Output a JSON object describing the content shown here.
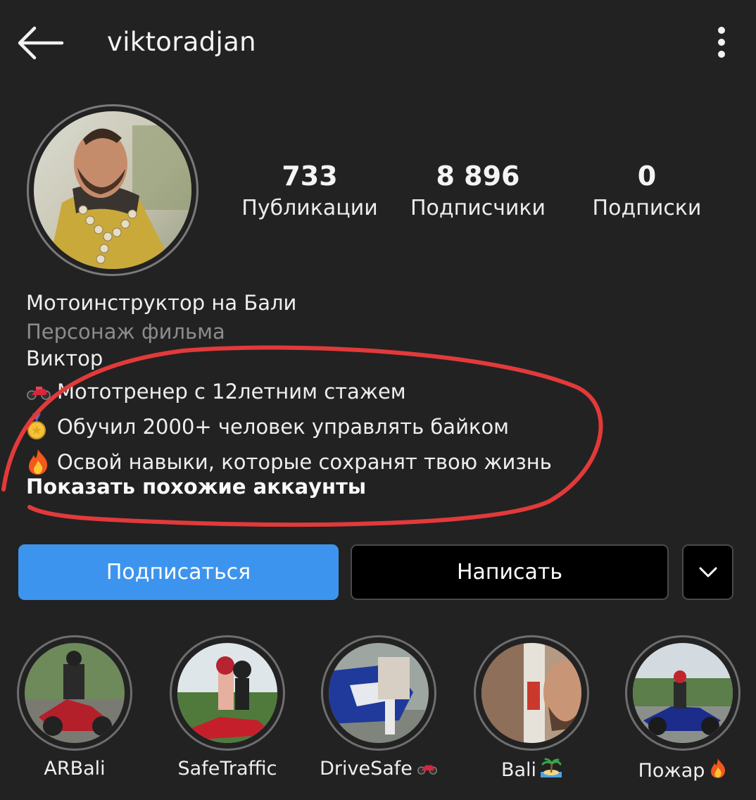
{
  "header": {
    "username": "viktoradjan",
    "back_icon": "arrow-left-icon",
    "more_icon": "kebab-menu-icon"
  },
  "profile": {
    "avatar": "profile-photo",
    "stats": {
      "posts": {
        "value": "733",
        "label": "Публикации"
      },
      "followers": {
        "value": "8 896",
        "label": "Подписчики"
      },
      "following": {
        "value": "0",
        "label": "Подписки"
      }
    }
  },
  "bio": {
    "name": "Мотоинструктор на Бали",
    "category": "Персонаж фильма",
    "first_line": "Виктор",
    "lines": [
      {
        "icon": "motorcycle-icon",
        "text": "Мототренер с 12летним стажем"
      },
      {
        "icon": "medal-icon",
        "text": "Обучил 2000+ человек управлять байком"
      },
      {
        "icon": "fire-icon",
        "text": "Освой навыки, которые сохранят твою жизнь"
      }
    ],
    "similar_accounts": "Показать похожие аккаунты"
  },
  "actions": {
    "follow_label": "Подписаться",
    "message_label": "Написать",
    "dropdown_icon": "chevron-down-icon"
  },
  "highlights": [
    {
      "label": "ARBali",
      "icon": ""
    },
    {
      "label": "SafeTraffic",
      "icon": ""
    },
    {
      "label": "DriveSafe",
      "icon": "motorcycle-icon"
    },
    {
      "label": "Bali",
      "icon": "island-icon"
    },
    {
      "label": "Пожар",
      "icon": "fire-icon"
    }
  ],
  "colors": {
    "background": "#222223",
    "primary_button": "#3d94ee",
    "annotation": "#e23a3a",
    "secondary_text": "#8c8c8c"
  }
}
